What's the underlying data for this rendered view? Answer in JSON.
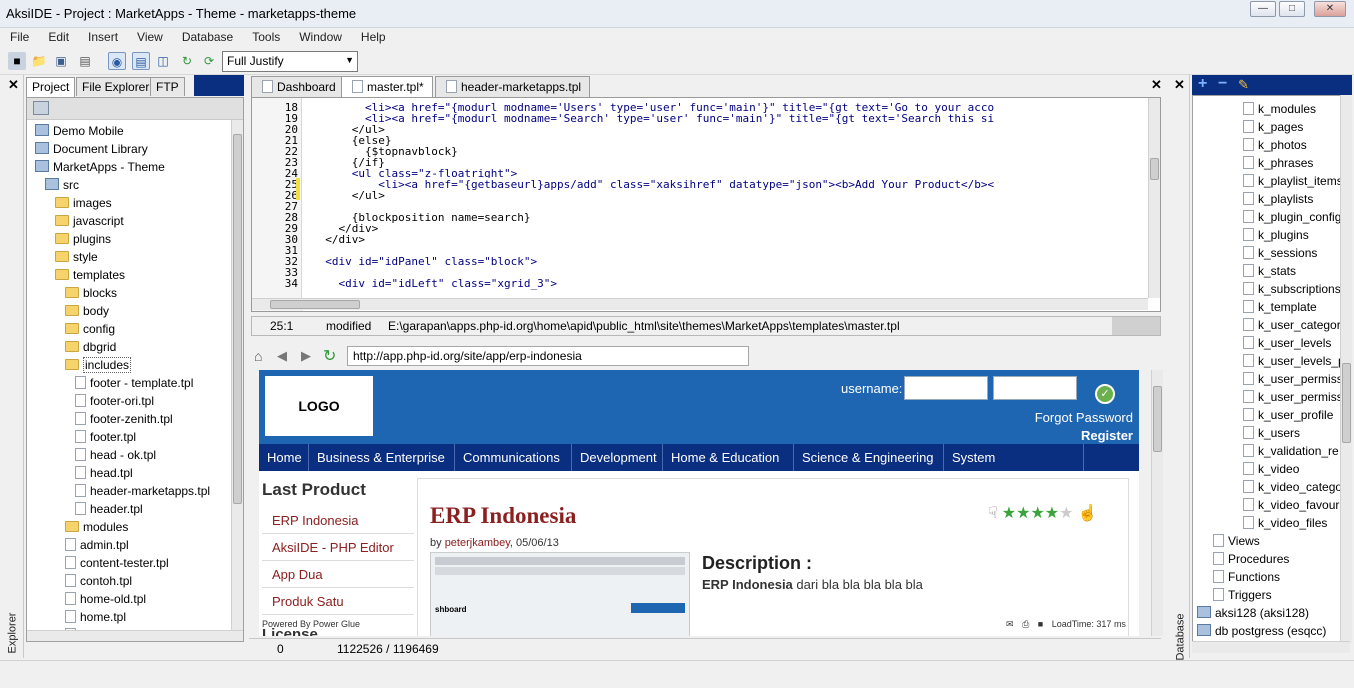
{
  "window": {
    "title": "AksiIDE - Project : MarketApps - Theme - marketapps-theme"
  },
  "menubar": [
    "File",
    "Edit",
    "Insert",
    "View",
    "Database",
    "Tools",
    "Window",
    "Help"
  ],
  "toolbar": {
    "justify_value": "Full Justify"
  },
  "left_panel": {
    "vertical_label": "Explorer",
    "tabs": [
      "Project",
      "File Explorer",
      "FTP"
    ],
    "tree": [
      {
        "label": "Demo Mobile",
        "icon": "db-icon",
        "indent": 0
      },
      {
        "label": "Document Library",
        "icon": "db-icon",
        "indent": 0
      },
      {
        "label": "MarketApps - Theme",
        "icon": "db-icon",
        "indent": 0
      },
      {
        "label": "src",
        "icon": "db-icon",
        "indent": 1
      },
      {
        "label": "images",
        "icon": "folder-icon",
        "indent": 2
      },
      {
        "label": "javascript",
        "icon": "folder-icon",
        "indent": 2
      },
      {
        "label": "plugins",
        "icon": "folder-icon",
        "indent": 2
      },
      {
        "label": "style",
        "icon": "folder-icon",
        "indent": 2
      },
      {
        "label": "templates",
        "icon": "folder-icon",
        "indent": 2
      },
      {
        "label": "blocks",
        "icon": "folder-icon",
        "indent": 3
      },
      {
        "label": "body",
        "icon": "folder-icon",
        "indent": 3
      },
      {
        "label": "config",
        "icon": "folder-icon",
        "indent": 3
      },
      {
        "label": "dbgrid",
        "icon": "folder-icon",
        "indent": 3
      },
      {
        "label": "includes",
        "icon": "folder-icon",
        "indent": 3
      },
      {
        "label": "footer - template.tpl",
        "icon": "file-icon",
        "indent": 4
      },
      {
        "label": "footer-ori.tpl",
        "icon": "file-icon",
        "indent": 4
      },
      {
        "label": "footer-zenith.tpl",
        "icon": "file-icon",
        "indent": 4
      },
      {
        "label": "footer.tpl",
        "icon": "file-icon",
        "indent": 4
      },
      {
        "label": "head - ok.tpl",
        "icon": "file-icon",
        "indent": 4
      },
      {
        "label": "head.tpl",
        "icon": "file-icon",
        "indent": 4
      },
      {
        "label": "header-marketapps.tpl",
        "icon": "file-icon",
        "indent": 4
      },
      {
        "label": "header.tpl",
        "icon": "file-icon",
        "indent": 4
      },
      {
        "label": "modules",
        "icon": "folder-icon",
        "indent": 3
      },
      {
        "label": "admin.tpl",
        "icon": "file-icon",
        "indent": 3
      },
      {
        "label": "content-tester.tpl",
        "icon": "file-icon",
        "indent": 3
      },
      {
        "label": "contoh.tpl",
        "icon": "file-icon",
        "indent": 3
      },
      {
        "label": "home-old.tpl",
        "icon": "file-icon",
        "indent": 3
      },
      {
        "label": "home.tpl",
        "icon": "file-icon",
        "indent": 3
      },
      {
        "label": "master - ori.tpl",
        "icon": "file-icon",
        "indent": 3
      }
    ]
  },
  "editor": {
    "tabs": [
      "Dashboard",
      "master.tpl*",
      "header-marketapps.tpl"
    ],
    "lines": [
      {
        "n": "18",
        "text": "        <li><a href=\"{modurl modname='Users' type='user' func='main'}\" title=\"{gt text='Go to your acco"
      },
      {
        "n": "19",
        "text": "        <li><a href=\"{modurl modname='Search' type='user' func='main'}\" title=\"{gt text='Search this si"
      },
      {
        "n": "20",
        "text": "      </ul>"
      },
      {
        "n": "21",
        "text": "      {else}"
      },
      {
        "n": "22",
        "text": "        {$topnavblock}"
      },
      {
        "n": "23",
        "text": "      {/if}"
      },
      {
        "n": "24",
        "text": "      <ul class=\"z-floatright\">"
      },
      {
        "n": "25",
        "text": "          <li><a href=\"{getbaseurl}apps/add\" class=\"xaksihref\" datatype=\"json\"><b>Add Your Product</b><"
      },
      {
        "n": "26",
        "text": "      </ul>"
      },
      {
        "n": "27",
        "text": ""
      },
      {
        "n": "28",
        "text": "      {blockposition name=search}"
      },
      {
        "n": "29",
        "text": "    </div>"
      },
      {
        "n": "30",
        "text": "  </div>"
      },
      {
        "n": "31",
        "text": ""
      },
      {
        "n": "32",
        "text": "  <div id=\"idPanel\" class=\"block\">"
      },
      {
        "n": "33",
        "text": ""
      },
      {
        "n": "34",
        "text": "    <div id=\"idLeft\" class=\"xgrid_3\">"
      }
    ],
    "status": {
      "position": "25:1",
      "state": "modified",
      "path": "E:\\garapan\\apps.php-id.org\\home\\apid\\public_html\\site\\themes\\MarketApps\\templates\\master.tpl"
    }
  },
  "browser": {
    "url": "http://app.php-id.org/site/app/erp-indonesia",
    "site": {
      "logo": "LOGO",
      "username_label": "username:",
      "forgot": "Forgot Password",
      "register": "Register",
      "nav": [
        "Home",
        "Business & Enterprise",
        "Communications",
        "Development",
        "Home & Education",
        "Science & Engineering",
        "System Administration"
      ],
      "last_product_title": "Last Product",
      "products": [
        "ERP Indonesia",
        "AksiIDE - PHP Editor",
        "App Dua",
        "Produk Satu"
      ],
      "powered": "Powered By Power Glue",
      "license": "License",
      "app_title": "ERP Indonesia",
      "byline_prefix": "by ",
      "byline_author": "peterjkambey",
      "byline_date": ", 05/06/13",
      "description_title": "Description :",
      "description_bold": "ERP Indonesia",
      "description_text": " dari bla bla bla bla bla",
      "loadtime": "LoadTime: 317 ms",
      "rating_stars": 4,
      "rating_max": 5
    }
  },
  "statusbar": {
    "left": "0",
    "memory": "1122526 / 1196469"
  },
  "right_panel": {
    "vertical_label": "Database",
    "tables": [
      "k_modules",
      "k_pages",
      "k_photos",
      "k_phrases",
      "k_playlist_items",
      "k_playlists",
      "k_plugin_config",
      "k_plugins",
      "k_sessions",
      "k_stats",
      "k_subscriptions",
      "k_template",
      "k_user_categorie",
      "k_user_levels",
      "k_user_levels_pe",
      "k_user_permissic",
      "k_user_permissic",
      "k_user_profile",
      "k_users",
      "k_validation_re",
      "k_video",
      "k_video_categor",
      "k_video_favourit",
      "k_video_files"
    ],
    "groups": [
      "Views",
      "Procedures",
      "Functions",
      "Triggers"
    ],
    "connections": [
      "aksi128 (aksi128)",
      "db postgress (esqcc)"
    ]
  },
  "colors": {
    "site_header": "#1f66b2",
    "site_nav": "#0a2e80",
    "app_title": "#8b2020",
    "star": "#3aa33a"
  }
}
